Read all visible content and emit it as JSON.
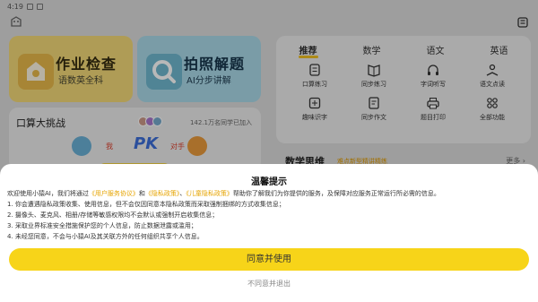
{
  "status_bar": {
    "time": "4:19"
  },
  "cards": {
    "check": {
      "title": "作业检查",
      "subtitle": "语数英全科"
    },
    "photo": {
      "title": "拍照解题",
      "subtitle": "AI分步讲解"
    }
  },
  "oral": {
    "title": "口算大挑战",
    "participants": "142.1万名同学已加入",
    "me_label": "我",
    "pk_label": "PK",
    "opponent_label": "对手"
  },
  "subject_tabs": [
    {
      "label": "推荐",
      "active": true
    },
    {
      "label": "数学",
      "active": false
    },
    {
      "label": "语文",
      "active": false
    },
    {
      "label": "英语",
      "active": false
    }
  ],
  "features": [
    {
      "label": "口算练习",
      "icon": "calculator-icon"
    },
    {
      "label": "同步练习",
      "icon": "book-icon"
    },
    {
      "label": "字词听写",
      "icon": "headphones-icon"
    },
    {
      "label": "语文点读",
      "icon": "reading-icon"
    },
    {
      "label": "趣味识字",
      "icon": "character-icon"
    },
    {
      "label": "同步作文",
      "icon": "notebook-icon"
    },
    {
      "label": "题目打印",
      "icon": "printer-icon"
    },
    {
      "label": "全部功能",
      "icon": "grid-icon"
    }
  ],
  "math_section": {
    "title": "数学思维",
    "subtitle": "难点新型精讲精练",
    "more": "更多 ›"
  },
  "dialog": {
    "title": "温馨提示",
    "intro_prefix": "欢迎使用小猿AI，我们将通过",
    "link_user_agreement": "《用户服务协议》",
    "and": "和",
    "link_privacy": "《隐私政策》",
    "comma": "、",
    "link_child_privacy": "《儿童隐私政策》",
    "intro_suffix": "帮助你了解我们为你提供的服务，及保障对应服务正常运行所必需的信息。",
    "items": [
      "1. 你会遭遇隐私政策收集、使用信息，但不会仅因同意本隐私政策而采取强制捆绑的方式收集信息；",
      "2. 摄像头、麦克风、相册/存储等敏感权限均不会默认或强制开启收集信息；",
      "3. 采取业界标准安全措施保护您的个人信息，防止数据泄露或滥用；",
      "4. 未经您同意，不会与小猿AI及其关联方外的任何组织共享个人信息。"
    ],
    "agree_label": "同意并使用",
    "decline_label": "不同意并退出"
  },
  "colors": {
    "accent_yellow": "#f7d419",
    "link_orange": "#e6a400"
  }
}
